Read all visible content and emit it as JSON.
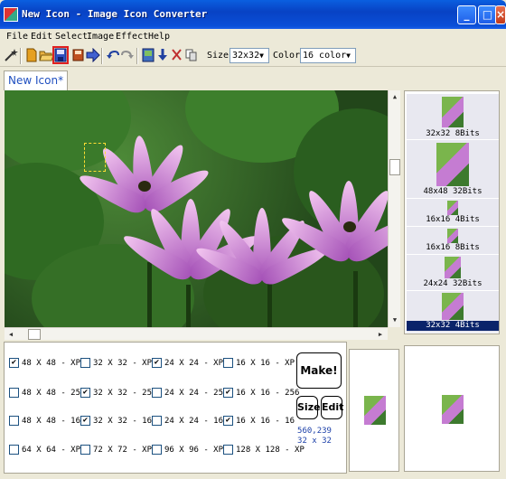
{
  "window": {
    "title": "New Icon - Image Icon Converter"
  },
  "menu": [
    "File",
    "Edit",
    "Select",
    "Image",
    "Effect",
    "Help"
  ],
  "toolbar": {
    "size_label": "Size:",
    "size_value": "32x32",
    "color_label": "Color:",
    "color_value": "16 color"
  },
  "tab": {
    "label": "New Icon*"
  },
  "thumbnails": [
    {
      "label": "32x32 8Bits"
    },
    {
      "label": "48x48 32Bits"
    },
    {
      "label": "16x16 4Bits"
    },
    {
      "label": "16x16 8Bits"
    },
    {
      "label": "24x24 32Bits"
    },
    {
      "label": "32x32 4Bits",
      "selected": true
    }
  ],
  "formats": [
    [
      {
        "label": "48 X 48 - XP",
        "checked": true
      },
      {
        "label": "32 X 32 - XP",
        "checked": false
      },
      {
        "label": "24 X 24 - XP",
        "checked": true
      },
      {
        "label": "16 X 16 - XP",
        "checked": false
      }
    ],
    [
      {
        "label": "48 X 48 - 256",
        "checked": false
      },
      {
        "label": "32 X 32 - 256",
        "checked": true
      },
      {
        "label": "24 X 24 - 256",
        "checked": false
      },
      {
        "label": "16 X 16 - 256",
        "checked": true
      }
    ],
    [
      {
        "label": "48 X 48 - 16",
        "checked": false
      },
      {
        "label": "32 X 32 - 16",
        "checked": true
      },
      {
        "label": "24 X 24 - 16",
        "checked": false
      },
      {
        "label": "16 X 16 - 16",
        "checked": true
      }
    ],
    [
      {
        "label": "64 X 64 - XP",
        "checked": false
      },
      {
        "label": "72 X 72 - XP",
        "checked": false
      },
      {
        "label": "96 X 96 - XP",
        "checked": false
      },
      {
        "label": "128 X 128 - XP",
        "checked": false
      }
    ]
  ],
  "actions": {
    "make": "Make!",
    "size": "Size",
    "edit": "Edit"
  },
  "status": {
    "position": "560,239",
    "size": "32 x 32"
  },
  "colors": {
    "title_bar": "#0a50d8",
    "selection": "#0a246a",
    "status_text": "#1b3fa8",
    "highlight_box": "#e02020"
  }
}
